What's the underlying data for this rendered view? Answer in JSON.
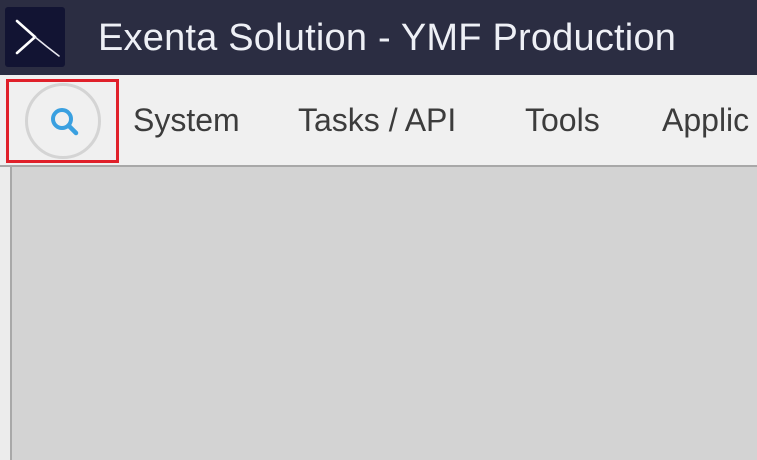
{
  "window": {
    "title": "Exenta Solution - YMF Production",
    "logo_icon": "exenta-logo-icon"
  },
  "menubar": {
    "search_icon": "search-icon",
    "items": [
      {
        "label": "System"
      },
      {
        "label": "Tasks / API"
      },
      {
        "label": "Tools"
      },
      {
        "label": "Applic"
      }
    ]
  },
  "colors": {
    "titlebar_bg": "#2b2d42",
    "menubar_bg": "#f0f0f0",
    "content_bg": "#d3d3d3",
    "highlight": "#e0202a",
    "search_icon": "#3aa0e0"
  }
}
